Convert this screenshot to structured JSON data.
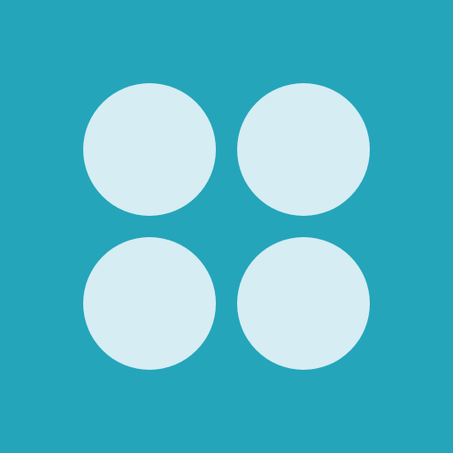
{
  "icon": {
    "name": "four-dots-grid-icon",
    "background_color": "#25A5BA",
    "dot_color": "#D5EDF3",
    "dot_count": 4,
    "rows": 2,
    "columns": 2
  }
}
